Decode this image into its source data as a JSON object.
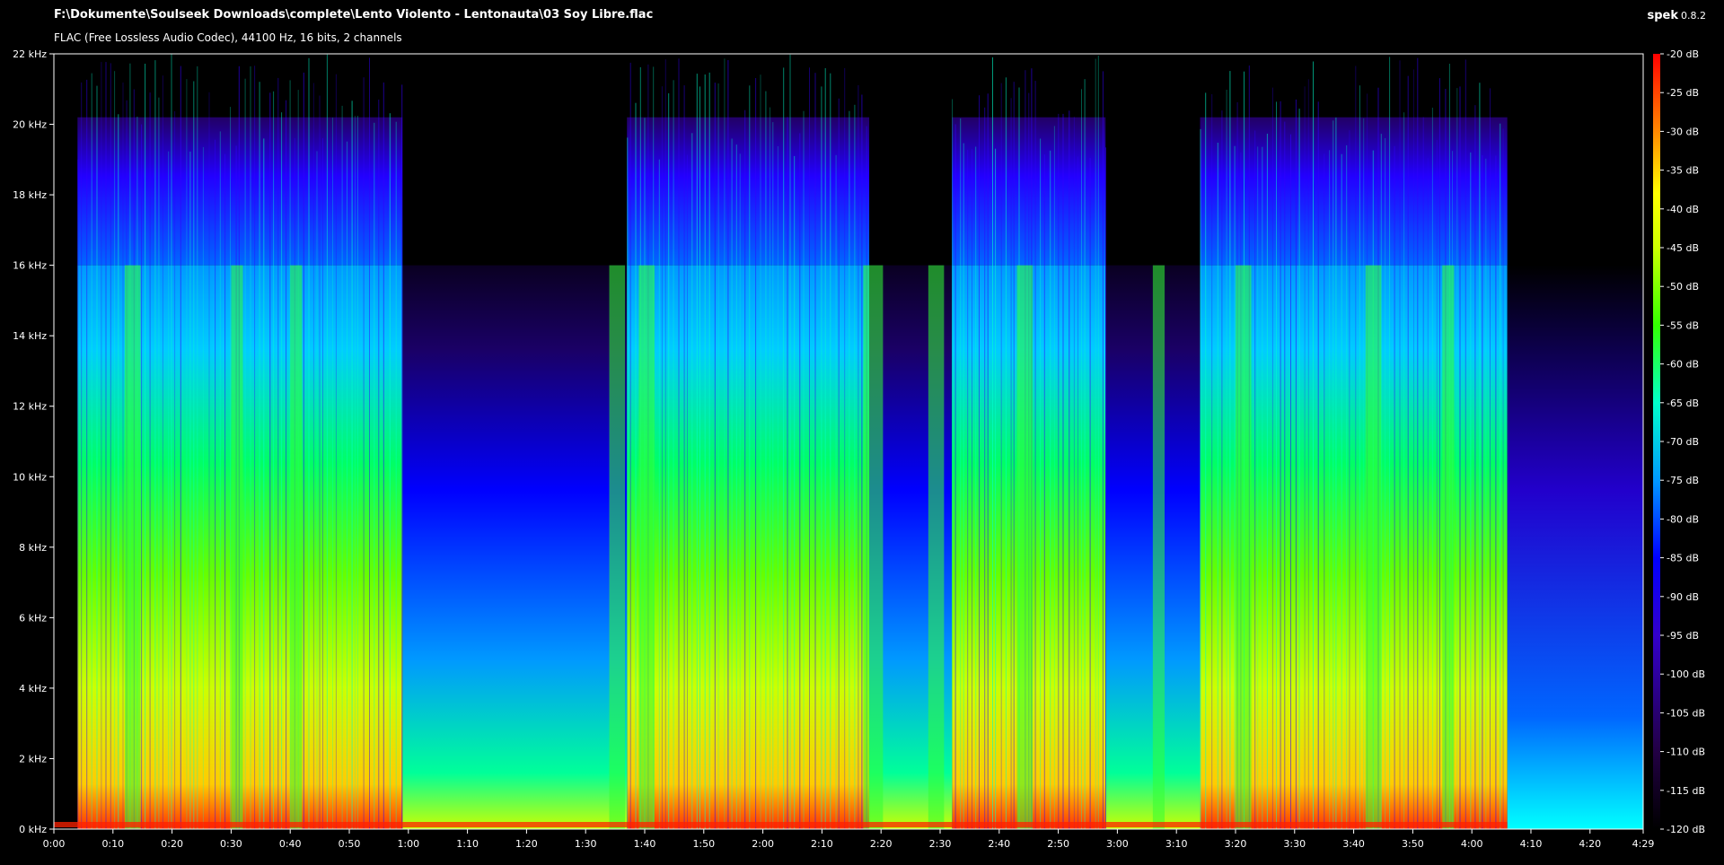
{
  "window": {
    "file_path": "F:\\Dokumente\\Soulseek Downloads\\complete\\Lento Violento - Lentonauta\\03 Soy Libre.flac",
    "file_info": "FLAC (Free Lossless Audio Codec), 44100 Hz, 16 bits, 2 channels",
    "app_name": "spek",
    "app_version": "0.8.2"
  },
  "colors": {
    "background": "#000000",
    "axis": "#ffffff",
    "palette": [
      "#000000",
      "#1a0033",
      "#3300aa",
      "#0000ff",
      "#0099ff",
      "#00ffff",
      "#00ff66",
      "#66ff00",
      "#ccff00",
      "#ffff00",
      "#ff9900",
      "#ff3300",
      "#ff0000"
    ]
  },
  "chart_data": {
    "type": "heatmap",
    "y_unit": "kHz",
    "ylim": [
      0,
      22
    ],
    "y_ticks": [
      "0 kHz",
      "2 kHz",
      "4 kHz",
      "6 kHz",
      "8 kHz",
      "10 kHz",
      "12 kHz",
      "14 kHz",
      "16 kHz",
      "18 kHz",
      "20 kHz",
      "22 kHz"
    ],
    "x_range_seconds": [
      0,
      269
    ],
    "x_ticks": [
      "0:00",
      "0:10",
      "0:20",
      "0:30",
      "0:40",
      "0:50",
      "1:00",
      "1:10",
      "1:20",
      "1:30",
      "1:40",
      "1:50",
      "2:00",
      "2:10",
      "2:20",
      "2:30",
      "2:40",
      "2:50",
      "3:00",
      "3:10",
      "3:20",
      "3:30",
      "3:40",
      "3:50",
      "4:00",
      "4:10",
      "4:20",
      "4:29"
    ],
    "x_tick_seconds": [
      0,
      10,
      20,
      30,
      40,
      50,
      60,
      70,
      80,
      90,
      100,
      110,
      120,
      130,
      140,
      150,
      160,
      170,
      180,
      190,
      200,
      210,
      220,
      230,
      240,
      250,
      260,
      269
    ],
    "colorbar_range_db": [
      -120,
      -20
    ],
    "colorbar_ticks": [
      "-20 dB",
      "-25 dB",
      "-30 dB",
      "-35 dB",
      "-40 dB",
      "-45 dB",
      "-50 dB",
      "-55 dB",
      "-60 dB",
      "-65 dB",
      "-70 dB",
      "-75 dB",
      "-80 dB",
      "-85 dB",
      "-90 dB",
      "-95 dB",
      "-100 dB",
      "-105 dB",
      "-110 dB",
      "-115 dB",
      "-120 dB"
    ],
    "loud_sections_seconds": [
      [
        4,
        59
      ],
      [
        97,
        138
      ],
      [
        152,
        178
      ],
      [
        194,
        246
      ]
    ],
    "quiet_sections_seconds": [
      [
        59,
        97
      ],
      [
        138,
        152
      ],
      [
        178,
        194
      ]
    ],
    "fade_out_seconds": [
      246,
      269
    ]
  }
}
